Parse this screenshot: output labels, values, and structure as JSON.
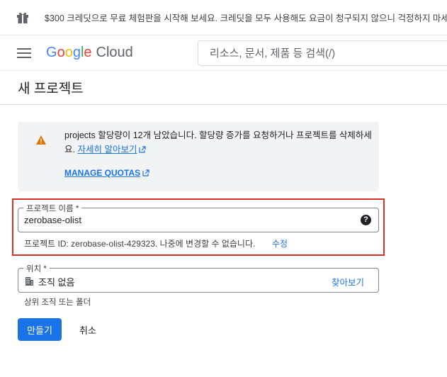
{
  "promo": {
    "icon": "gift-icon",
    "text": "$300 크레딧으로 무료 체험판을 시작해 보세요. 크레딧을 모두 사용해도 요금이 청구되지 않으니 걱정하지 마세요."
  },
  "header": {
    "menu_icon": "hamburger-menu-icon",
    "logo": {
      "word": "Google",
      "product": "Cloud"
    },
    "search": {
      "placeholder": "리소스, 문서, 제품 등 검색(/)",
      "value": ""
    }
  },
  "page": {
    "title": "새 프로젝트"
  },
  "notice": {
    "icon": "warning-icon",
    "message": "projects 할당량이 12개 남았습니다. 할당량 증가를 요청하거나 프로젝트를 삭제하세요.",
    "learn_more": "자세히 알아보기",
    "manage_quotas": "MANAGE QUOTAS"
  },
  "form": {
    "project_name": {
      "label": "프로젝트 이름 *",
      "value": "zerobase-olist",
      "help_icon": "help-icon"
    },
    "project_id": {
      "text": "프로젝트 ID: zerobase-olist-429323. 나중에 변경할 수 없습니다.",
      "edit_label": "수정"
    },
    "location": {
      "label": "위치 *",
      "value": "조직 없음",
      "icon": "building-icon",
      "browse_label": "찾아보기",
      "hint": "상위 조직 또는 폴더"
    }
  },
  "actions": {
    "create_label": "만들기",
    "cancel_label": "취소"
  },
  "colors": {
    "primary": "#1a73e8",
    "highlight_border": "#d93025",
    "warning": "#e37400",
    "notice_bg": "#f1f3f4"
  }
}
